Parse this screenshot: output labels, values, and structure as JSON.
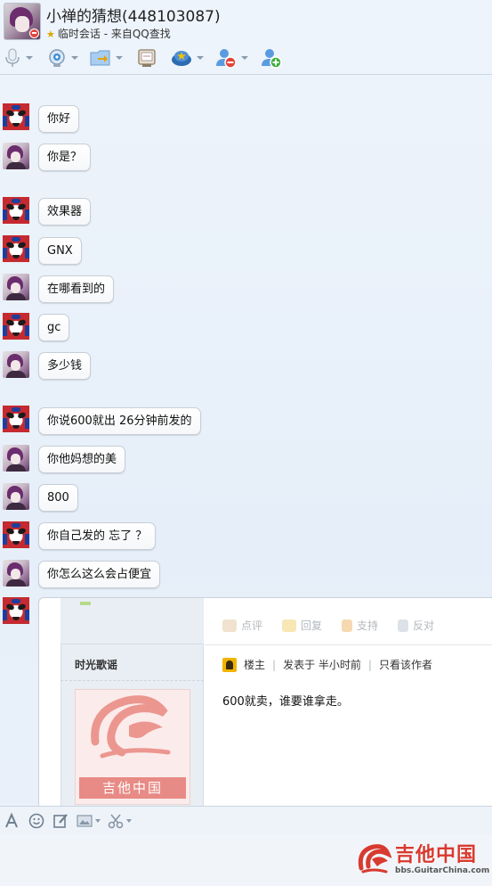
{
  "header": {
    "title": "小禅的猜想(448103087)",
    "subtitle": "临时会话 - 来自QQ查找",
    "toolbar_icons": [
      "microphone-icon",
      "video-icon",
      "file-transfer-icon",
      "screen-share-icon",
      "remote-assist-icon",
      "block-user-icon",
      "add-friend-icon"
    ]
  },
  "messages": [
    {
      "sender": "me",
      "text": "你好"
    },
    {
      "sender": "other",
      "text": "你是？"
    },
    {
      "sender": "me",
      "text": "效果器"
    },
    {
      "sender": "me",
      "text": "GNX"
    },
    {
      "sender": "other",
      "text": "在哪看到的"
    },
    {
      "sender": "me",
      "text": "gc"
    },
    {
      "sender": "other",
      "text": "多少钱"
    },
    {
      "sender": "me",
      "text": "你说600就出 26分钟前发的"
    },
    {
      "sender": "other",
      "text": "你他妈想的美"
    },
    {
      "sender": "other",
      "text": "800"
    },
    {
      "sender": "me",
      "text": "你自己发的 忘了 ？"
    },
    {
      "sender": "other",
      "text": "你怎么这么会占便宜"
    }
  ],
  "screenshot_post": {
    "actions": [
      "点评",
      "回复",
      "支持",
      "反对"
    ],
    "author": "时光歌谣",
    "role": "楼主",
    "posted": "发表于 半小时前",
    "view_author_only": "只看该作者",
    "content": "600就卖，谁要谁拿走。",
    "logo_text": "吉他中国"
  },
  "input_toolbar_icons": [
    "font-icon",
    "emoji-icon",
    "edit-icon",
    "image-icon",
    "scissors-icon"
  ],
  "watermark": {
    "main": "吉他中国",
    "url": "bbs.GuitarChina.com"
  },
  "colors": {
    "background": "#e9f0f9",
    "bubble_border": "#c7ced6",
    "status_busy": "#e2463b",
    "accent_star": "#e0a400",
    "watermark_red": "#d93a2f"
  }
}
